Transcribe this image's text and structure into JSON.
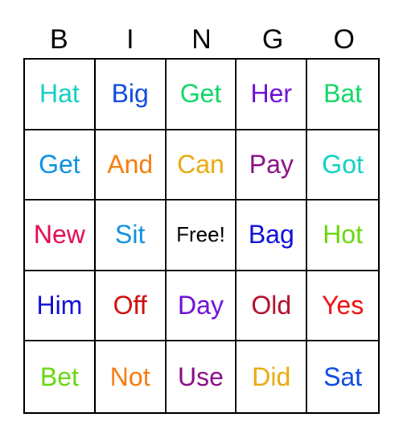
{
  "header": {
    "letters": [
      "B",
      "I",
      "N",
      "G",
      "O"
    ]
  },
  "board": {
    "rows": [
      [
        {
          "word": "Hat",
          "color": "#0ccfc2"
        },
        {
          "word": "Big",
          "color": "#0a47e0"
        },
        {
          "word": "Get",
          "color": "#0ad663"
        },
        {
          "word": "Her",
          "color": "#6b0ad4"
        },
        {
          "word": "Bat",
          "color": "#0ad663"
        }
      ],
      [
        {
          "word": "Get",
          "color": "#0a8fe0"
        },
        {
          "word": "And",
          "color": "#f57a0a"
        },
        {
          "word": "Can",
          "color": "#e8a90a"
        },
        {
          "word": "Pay",
          "color": "#870a84"
        },
        {
          "word": "Got",
          "color": "#0ccfc2"
        }
      ],
      [
        {
          "word": "New",
          "color": "#e00a4f"
        },
        {
          "word": "Sit",
          "color": "#0a8fe0"
        },
        {
          "word": "Free!",
          "color": "#000000",
          "free": true
        },
        {
          "word": "Bag",
          "color": "#0a0ad4"
        },
        {
          "word": "Hot",
          "color": "#66d60a"
        }
      ],
      [
        {
          "word": "Him",
          "color": "#0a0ad4"
        },
        {
          "word": "Off",
          "color": "#cc0a0a"
        },
        {
          "word": "Day",
          "color": "#6b0ad4"
        },
        {
          "word": "Old",
          "color": "#b00a2a"
        },
        {
          "word": "Yes",
          "color": "#f00a0a"
        }
      ],
      [
        {
          "word": "Bet",
          "color": "#66d60a"
        },
        {
          "word": "Not",
          "color": "#f57a0a"
        },
        {
          "word": "Use",
          "color": "#870a84"
        },
        {
          "word": "Did",
          "color": "#e8a90a"
        },
        {
          "word": "Sat",
          "color": "#0a47e0"
        }
      ]
    ]
  }
}
